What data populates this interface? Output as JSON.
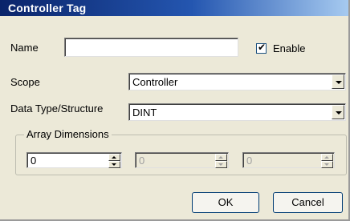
{
  "window": {
    "title": "Controller Tag"
  },
  "form": {
    "name_label": "Name",
    "name_value": "",
    "enable_label": "Enable",
    "enable_checked": true,
    "scope_label": "Scope",
    "scope_value": "Controller",
    "datatype_label": "Data Type/Structure",
    "datatype_value": "DINT"
  },
  "array_dimensions": {
    "legend": "Array Dimensions",
    "dims": [
      "0",
      "0",
      "0"
    ]
  },
  "buttons": {
    "ok": "OK",
    "cancel": "Cancel"
  }
}
